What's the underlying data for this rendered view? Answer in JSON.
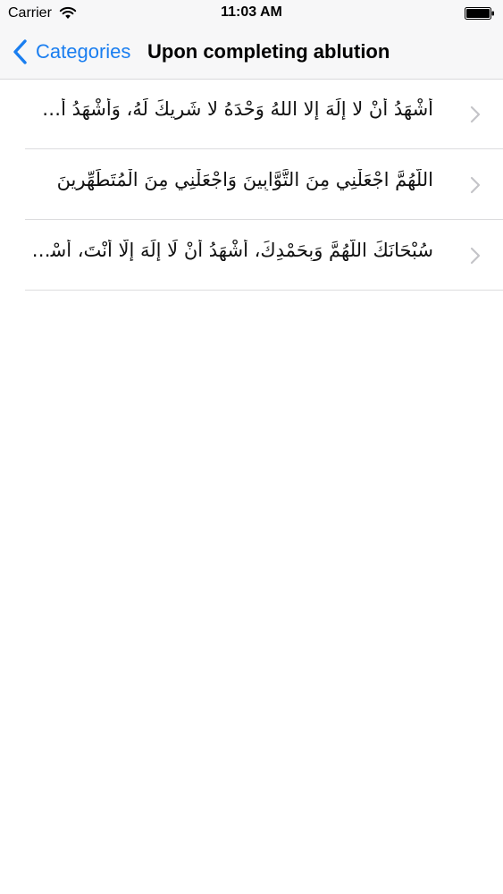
{
  "status_bar": {
    "carrier": "Carrier",
    "time": "11:03 AM",
    "wifi_icon": "wifi-icon",
    "battery_icon": "battery-icon"
  },
  "nav": {
    "back_label": "Categories",
    "back_icon": "chevron-left-icon",
    "title": "Upon completing ablution",
    "accent_color": "#1a7ef0"
  },
  "rows": [
    {
      "text": "أَشْهَدُ أَنْ لا إِلَهَ إِلا اللهُ وَحْدَهُ لا شَرِيكَ لَهُ، وَأَشْهَدُ أَنَّ مُحَمَّدًا عَبْدُهُ وَرَسُولُهُ"
    },
    {
      "text": "اللَّهُمَّ اجْعَلْنِي مِنَ التَّوَّابِينَ وَاجْعَلْنِي مِنَ الْمُتَطَهِّرِينَ"
    },
    {
      "text": "سُبْحَانَكَ اللَّهُمَّ وَبِحَمْدِكَ، أَشْهَدُ أَنْ لَا إِلَهَ إِلَّا أَنْتَ، أَسْتَغْفِرُكَ وَأَتُوبُ إِلَيْكَ"
    }
  ]
}
